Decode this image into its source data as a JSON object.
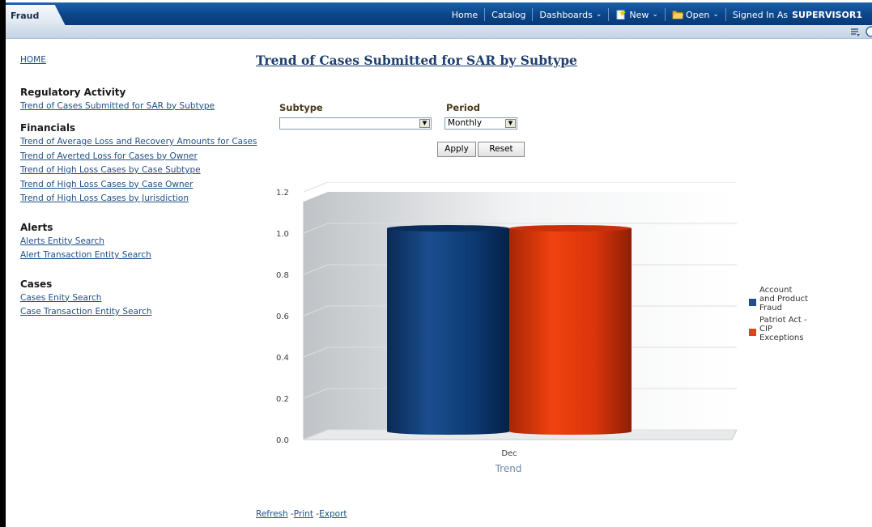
{
  "app": {
    "tab": "Fraud"
  },
  "topnav": {
    "home": "Home",
    "catalog": "Catalog",
    "dashboards": "Dashboards",
    "new": "New",
    "open": "Open",
    "signed_in_label": "Signed In As",
    "user": "SUPERVISOR1"
  },
  "sidebar": {
    "home_link": "HOME",
    "sections": [
      {
        "title": "Regulatory Activity",
        "links": [
          "Trend of Cases Submitted for SAR by Subtype"
        ]
      },
      {
        "title": "Financials",
        "links": [
          "Trend of Average Loss and Recovery Amounts for Cases",
          "Trend of Averted Loss for Cases by Owner",
          "Trend of High Loss Cases by Case Subtype",
          "Trend of High Loss Cases by Case Owner",
          "Trend of High Loss Cases by Jurisdiction"
        ]
      },
      {
        "title": "Alerts",
        "links": [
          "Alerts Entity Search",
          "Alert Transaction Entity Search"
        ]
      },
      {
        "title": "Cases",
        "links": [
          "Cases Enity Search",
          "Case Transaction Entity Search"
        ]
      }
    ]
  },
  "report": {
    "title": "Trend of Cases Submitted for SAR by Subtype"
  },
  "prompts": {
    "subtype_label": "Subtype",
    "subtype_value": "",
    "period_label": "Period",
    "period_value": "Monthly",
    "apply": "Apply",
    "reset": "Reset"
  },
  "colors": {
    "series1": "#0e3a72",
    "series2": "#e03a10"
  },
  "chart_data": {
    "type": "bar",
    "categories": [
      "Dec"
    ],
    "series": [
      {
        "name": "Account and Product Fraud",
        "values": [
          1.0
        ]
      },
      {
        "name": "Patriot Act - CIP Exceptions",
        "values": [
          1.0
        ]
      }
    ],
    "xlabel": "Trend",
    "ylabel": "",
    "ylim": [
      0,
      1.2
    ],
    "yticks": [
      "0.0",
      "0.2",
      "0.4",
      "0.6",
      "0.8",
      "1.0",
      "1.2"
    ],
    "grid": true,
    "legend": "right"
  },
  "footer": {
    "refresh": "Refresh",
    "print": "Print",
    "export": "Export"
  }
}
